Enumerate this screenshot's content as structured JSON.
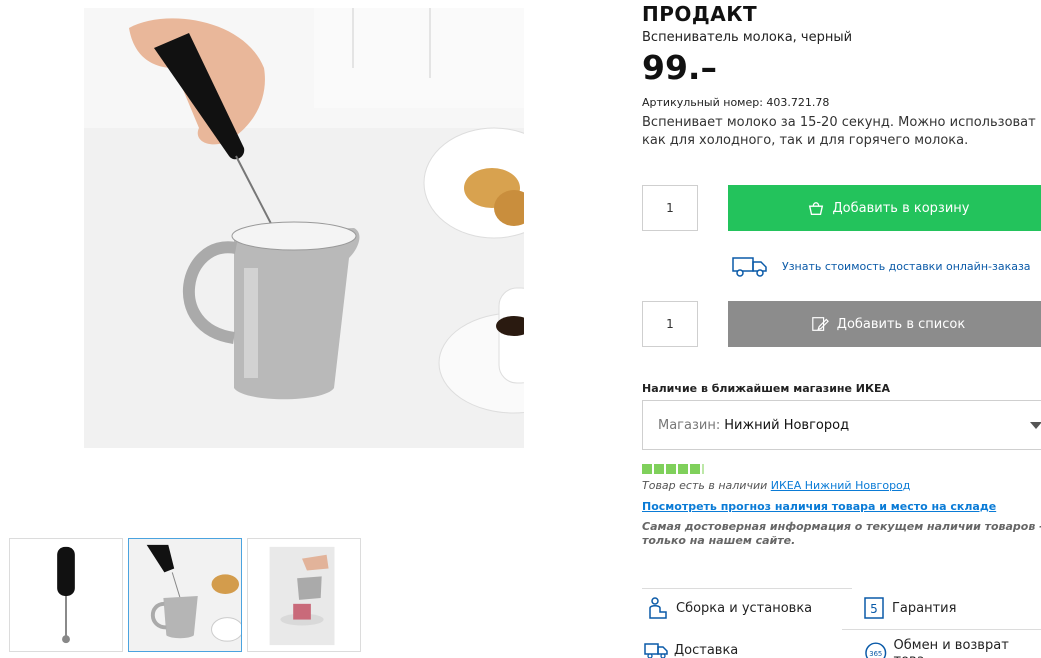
{
  "product": {
    "name": "ПРОДАКТ",
    "subtitle": "Вспениватель молока, черный",
    "price": "99.–",
    "article": "Артикульный номер: 403.721.78",
    "description": "Вспенивает молоко за 15-20 секунд. Можно использоват\nкак для холодного, так и для горячего молока."
  },
  "purchase": {
    "qty_cart": "1",
    "add_to_cart": "Добавить в корзину",
    "delivery_link": "Узнать стоимость доставки онлайн-заказа",
    "qty_list": "1",
    "add_to_list": "Добавить в список"
  },
  "availability": {
    "heading": "Наличие в ближайшем магазине ИКЕА",
    "store_label": "Магазин:",
    "store_value": "Нижний Новгород",
    "stock_level": 1.0,
    "stock_text": "Товар есть в наличии",
    "stock_store_link": "ИКЕА Нижний Новгород",
    "forecast_link": "Посмотреть прогноз наличия товара и место на складе",
    "note": "Самая достоверная информация о текущем наличии товаров -\nтолько на нашем сайте."
  },
  "services": {
    "assembly": "Сборка и установка",
    "warranty": "Гарантия",
    "warranty_badge": "5",
    "delivery": "Доставка",
    "returns": "Обмен и возврат това",
    "returns_badge": "365"
  },
  "colors": {
    "cart_button": "#23c35c",
    "list_button": "#8c8c8c",
    "link": "#0a7bd6",
    "stock": "#7fd05b"
  },
  "icons": {
    "cart": "bag-icon",
    "list": "edit-list-icon",
    "truck": "truck-icon",
    "assembly": "assembly-person-icon",
    "warranty": "warranty-badge-icon",
    "returns": "returns-badge-icon"
  }
}
